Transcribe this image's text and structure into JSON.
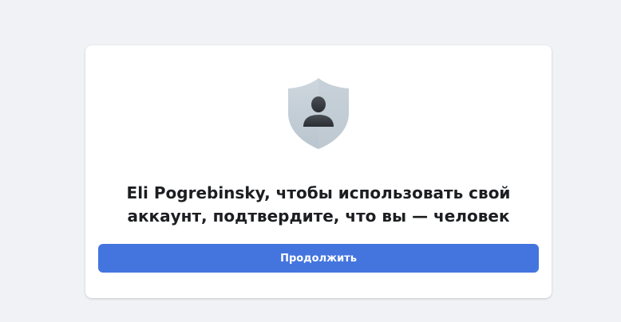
{
  "card": {
    "icon": "shield-user-icon",
    "headline": "Eli Pogrebinsky, чтобы использовать свой аккаунт, подтвердите, что вы — человек",
    "continue_label": "Продолжить"
  },
  "colors": {
    "page_background": "#f0f2f5",
    "card_background": "#ffffff",
    "button_background": "#4475df",
    "button_text": "#ffffff",
    "headline_text": "#1c1e21"
  }
}
